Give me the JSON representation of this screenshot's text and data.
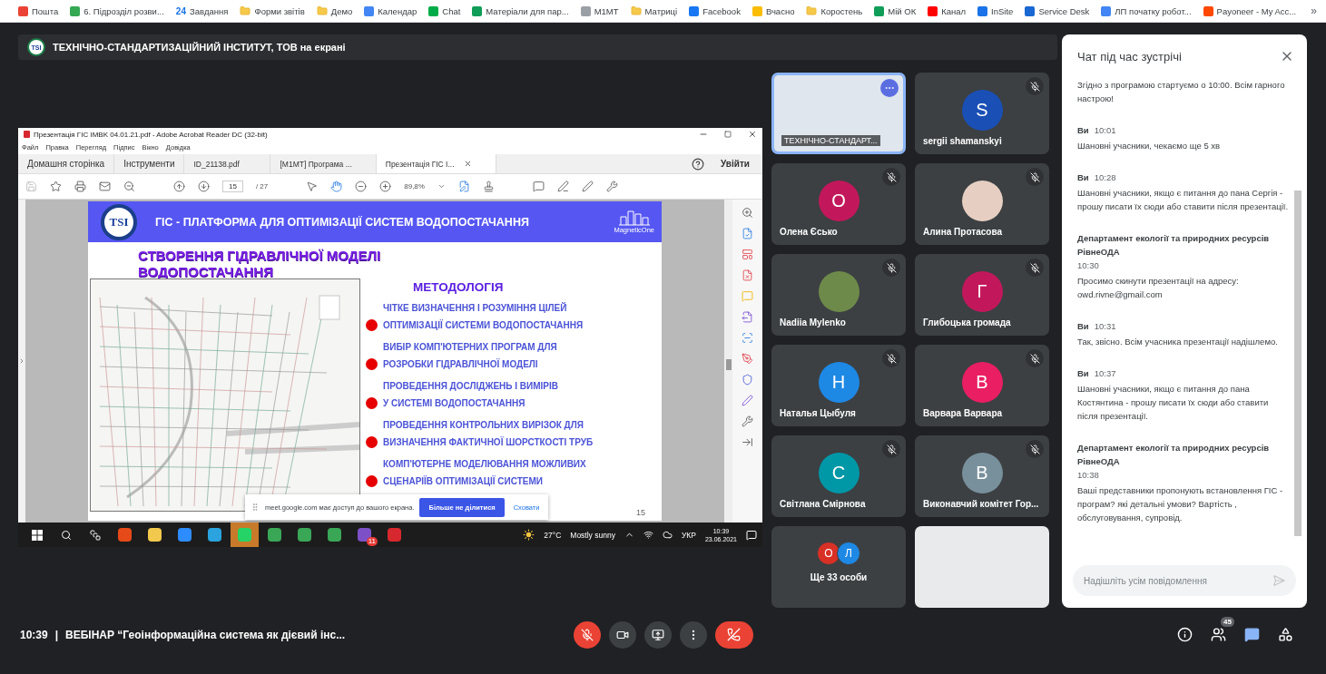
{
  "bookmarks": {
    "items": [
      {
        "label": "Пошта",
        "kind": "mail"
      },
      {
        "label": "6. Підрозділ розви...",
        "kind": "drive"
      },
      {
        "label": "Завдання",
        "kind": "tasks",
        "icon_text": "24"
      },
      {
        "label": "Форми звітів",
        "kind": "folder"
      },
      {
        "label": "Демо",
        "kind": "folder"
      },
      {
        "label": "Календар",
        "kind": "calendar"
      },
      {
        "label": "Chat",
        "kind": "chat"
      },
      {
        "label": "Матеріали для пар...",
        "kind": "sheet"
      },
      {
        "label": "М1МТ",
        "kind": "building"
      },
      {
        "label": "Матриці",
        "kind": "folder"
      },
      {
        "label": "Facebook",
        "kind": "facebook"
      },
      {
        "label": "Вчасно",
        "kind": "smile"
      },
      {
        "label": "Коростень",
        "kind": "folder"
      },
      {
        "label": "Мій ОК",
        "kind": "sheet"
      },
      {
        "label": "Канал",
        "kind": "youtube"
      },
      {
        "label": "InSite",
        "kind": "site"
      },
      {
        "label": "Service Desk",
        "kind": "service"
      },
      {
        "label": "ЛП початку робот...",
        "kind": "doc"
      },
      {
        "label": "Payoneer - My Acc...",
        "kind": "payoneer"
      }
    ],
    "more": "»"
  },
  "presenter_bar": {
    "logo_text": "TSI",
    "text": "ТЕХНІЧНО-СТАНДАРТИЗАЦІЙНИЙ ІНСТИТУТ, ТОВ на екрані"
  },
  "shared_screen": {
    "acrobat": {
      "title": "Презентація ГІС IMBK 04.01.21.pdf - Adobe Acrobat Reader DC (32-bit)",
      "menu": [
        "Файл",
        "Правка",
        "Перегляд",
        "Підпис",
        "Вікно",
        "Довідка"
      ],
      "tabs": [
        {
          "label": "Домашня сторінка",
          "selected": false,
          "kind": "nav"
        },
        {
          "label": "Інструменти",
          "selected": false,
          "kind": "nav"
        },
        {
          "label": "ID_21138.pdf",
          "selected": false,
          "kind": "doc"
        },
        {
          "label": "[M1MT] Програма ...",
          "selected": false,
          "kind": "doc"
        },
        {
          "label": "Презентація ГІС І...",
          "selected": true,
          "kind": "doc"
        }
      ],
      "sign_in": "Увійти",
      "page": "15",
      "page_total": "/ 27",
      "zoom": "89,8%"
    },
    "slide": {
      "logo_text": "TSI",
      "title": "ГІС - ПЛАТФОРМА ДЛЯ ОПТИМІЗАЦІЇ СИСТЕМ ВОДОПОСТАЧАННЯ",
      "brand": "MagneticOne",
      "subtitle_lines": [
        "СТВОРЕННЯ ГІДРАВЛІЧНОЇ МОДЕЛІ",
        "ВОДОПОСТАЧАННЯ"
      ],
      "heading": "МЕТОДОЛОГІЯ",
      "items": [
        {
          "lines": [
            "ЧІТКЕ ВИЗНАЧЕННЯ І РОЗУМІННЯ ЦІЛЕЙ",
            "ОПТИМІЗАЦІЇ СИСТЕМИ ВОДОПОСТАЧАННЯ"
          ]
        },
        {
          "lines": [
            "ВИБІР КОМП'ЮТЕРНИХ ПРОГРАМ ДЛЯ",
            "РОЗРОБКИ ГІДРАВЛІЧНОЇ МОДЕЛІ"
          ]
        },
        {
          "lines": [
            "ПРОВЕДЕННЯ ДОСЛІДЖЕНЬ І ВИМІРІВ",
            "У СИСТЕМІ ВОДОПОСТАЧАННЯ"
          ]
        },
        {
          "lines": [
            "ПРОВЕДЕННЯ КОНТРОЛЬНИХ ВИРІЗОК ДЛЯ",
            "ВИЗНАЧЕННЯ ФАКТИЧНОЇ ШОРСТКОСТІ ТРУБ"
          ]
        },
        {
          "lines": [
            "КОМП'ЮТЕРНЕ МОДЕЛЮВАННЯ МОЖЛИВИХ",
            "СЦЕНАРІЇВ ОПТИМІЗАЦІЇ СИСТЕМИ"
          ]
        }
      ],
      "page_number": "15"
    },
    "share_notice": {
      "text": "meet.google.com має доступ до вашого екрана.",
      "stop": "Більше не ділитися",
      "hide": "Сховати"
    },
    "taskbar": {
      "apps": [
        {
          "kind": "office",
          "highlighted": false
        },
        {
          "kind": "explorer",
          "highlighted": false
        },
        {
          "kind": "zoom",
          "highlighted": false
        },
        {
          "kind": "telegram",
          "highlighted": false
        },
        {
          "kind": "whatsapp",
          "highlighted": true
        },
        {
          "kind": "chrome",
          "highlighted": false
        },
        {
          "kind": "chrome",
          "highlighted": false
        },
        {
          "kind": "chrome",
          "highlighted": false
        },
        {
          "kind": "viber",
          "highlighted": false,
          "badge": "11"
        },
        {
          "kind": "acrobat",
          "highlighted": false
        }
      ],
      "weather": "27°C",
      "weather_text": "Mostly sunny",
      "lang": "УКР",
      "time": "10:39",
      "date": "23.06.2021"
    }
  },
  "participants": [
    {
      "kind": "video",
      "name": "ТЕХНІЧНО-СТАНДАРТ...",
      "muted": false,
      "highlighted": true
    },
    {
      "kind": "letter",
      "name": "sergii shamanskyi",
      "letter": "S",
      "color": "#1a4fb5",
      "muted": true,
      "highlighted": false
    },
    {
      "kind": "letter",
      "name": "Олена Єсько",
      "letter": "О",
      "color": "#c2185b",
      "muted": true,
      "highlighted": false
    },
    {
      "kind": "photo",
      "name": "Алина Протасова",
      "muted": true,
      "highlighted": false
    },
    {
      "kind": "photo",
      "name": "Nadiia Mylenko",
      "muted": true,
      "highlighted": false
    },
    {
      "kind": "letter",
      "name": "Глибоцька громада",
      "letter": "Г",
      "color": "#c2185b",
      "muted": true,
      "highlighted": false
    },
    {
      "kind": "letter",
      "name": "Наталья Цыбуля",
      "letter": "Н",
      "color": "#1e88e5",
      "muted": true,
      "highlighted": false
    },
    {
      "kind": "letter",
      "name": "Варвара Варвара",
      "letter": "В",
      "color": "#e91e63",
      "muted": true,
      "highlighted": false
    },
    {
      "kind": "letter",
      "name": "Світлана Смірнова",
      "letter": "С",
      "color": "#0097a7",
      "muted": true,
      "highlighted": false
    },
    {
      "kind": "letter",
      "name": "Виконавчий комітет Гор...",
      "letter": "В",
      "color": "#78909c",
      "muted": true,
      "highlighted": false
    },
    {
      "kind": "more",
      "name": "Ще 33 особи",
      "muted": false,
      "highlighted": false,
      "avatars": [
        {
          "letter": "О",
          "color": "#d93025"
        },
        {
          "letter": "Л",
          "color": "#1e88e5"
        }
      ]
    },
    {
      "kind": "camera",
      "muted": false,
      "highlighted": false
    }
  ],
  "chat": {
    "title": "Чат під час зустрічі",
    "placeholder": "Надішліть усім повідомлення",
    "messages": [
      {
        "text": "Згідно з програмою стартуємо о 10:00. Всім гарного настрою!"
      },
      {
        "sender": "Ви",
        "time": "10:01",
        "text": "Шановні учасники, чекаємо ще 5 хв"
      },
      {
        "sender": "Ви",
        "time": "10:28",
        "text": "Шановні учасники, якщо є питання до пана Сергія - прошу писати їх сюди або ставити після презентації."
      },
      {
        "sender": "Департамент екології та природних ресурсів РівнеОДА",
        "time": "10:30",
        "text": "Просимо скинути презентації на адресу: owd.rivne@gmail.com"
      },
      {
        "sender": "Ви",
        "time": "10:31",
        "text": "Так, звісно. Всім учасника презентації надішлемо."
      },
      {
        "sender": "Ви",
        "time": "10:37",
        "text": "Шановні учасники, якщо є питання до пана Костянтина - прошу писати їх сюди або ставити після презентації."
      },
      {
        "sender": "Департамент екології та природних ресурсів РівнеОДА",
        "time": "10:38",
        "text": "Ваші представники пропонують встановлення ГІС - програм? які детальні умови? Вартість , обслуговування, супровід."
      }
    ]
  },
  "meeting_bar": {
    "time": "10:39",
    "separator": "|",
    "title": "ВЕБІНАР “Геоінформаційна система як дієвий інс...",
    "controls": [
      {
        "kind": "mic",
        "muted": true
      },
      {
        "kind": "camera"
      },
      {
        "kind": "present"
      },
      {
        "kind": "more"
      },
      {
        "kind": "leave"
      }
    ],
    "people_count": "45"
  }
}
